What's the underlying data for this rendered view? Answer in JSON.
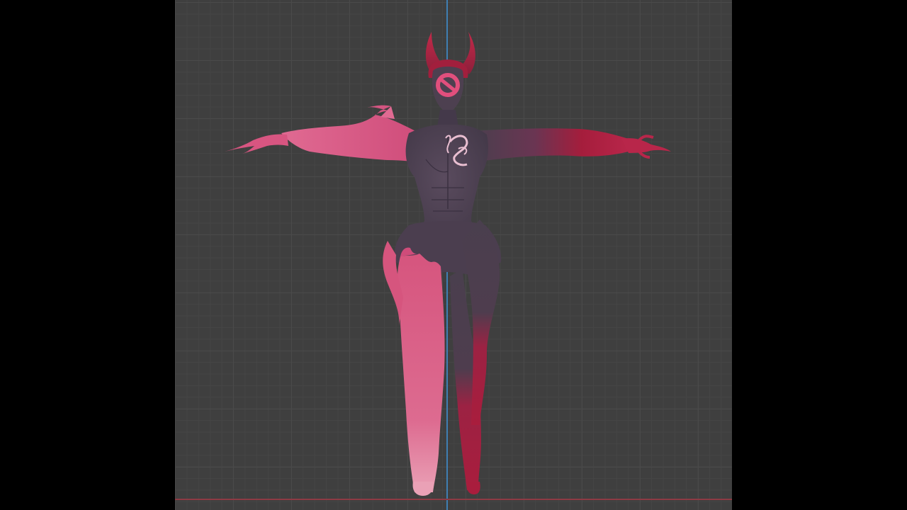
{
  "viewport": {
    "view": "front-orthographic",
    "background_color": "#3f3f3f",
    "grid_major_color": "#4a4a4a",
    "grid_minor_color": "#454545",
    "axis_z_color": "#3f7fb3",
    "axis_x_color": "#8e3a44"
  },
  "model": {
    "pose": "T-pose",
    "colors": {
      "body_dark": "#4a3f4e",
      "pink": "#d9577f",
      "light_pink": "#e47a9d",
      "crimson": "#a51d3c",
      "horn_red": "#b01f3c"
    }
  }
}
